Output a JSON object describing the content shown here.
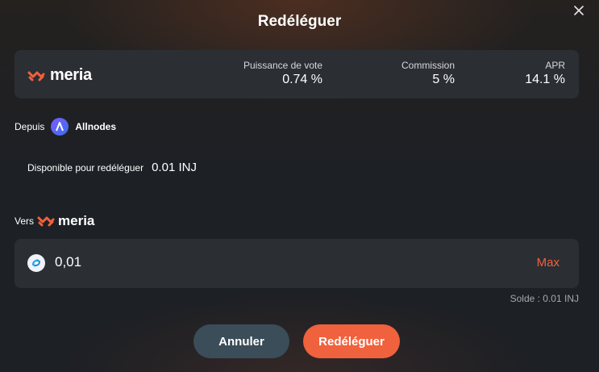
{
  "modal": {
    "title": "Redéléguer"
  },
  "validator_card": {
    "brand": "meria",
    "stats": [
      {
        "label": "Puissance de vote",
        "value": "0.74 %"
      },
      {
        "label": "Commission",
        "value": "5 %"
      },
      {
        "label": "APR",
        "value": "14.1 %"
      }
    ]
  },
  "from": {
    "label": "Depuis",
    "validator": "Allnodes"
  },
  "available": {
    "label": "Disponible pour redéléguer",
    "value": "0.01 INJ"
  },
  "to": {
    "label": "Vers",
    "brand": "meria"
  },
  "amount": {
    "value": "0,01",
    "max_label": "Max"
  },
  "balance": "Solde : 0.01 INJ",
  "buttons": {
    "cancel": "Annuler",
    "confirm": "Redéléguer"
  },
  "colors": {
    "accent": "#f0613d",
    "card": "#2b2e33",
    "cancel": "#3a4d58"
  },
  "icons": {
    "close": "close-icon",
    "brand": "meria-logo-icon",
    "validator": "allnodes-logo-icon",
    "token": "injective-token-icon"
  }
}
